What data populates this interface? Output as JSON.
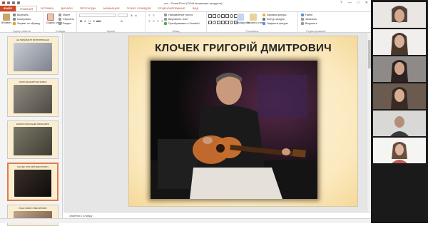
{
  "titlebar": {
    "document_title": "xxx - PowerPoint (Сбой активации продукта)",
    "window_buttons": [
      "?",
      "—",
      "□",
      "✕"
    ]
  },
  "ribbon_tabs": [
    "ФАЙЛ",
    "ГЛАВНАЯ",
    "ВСТАВКА",
    "ДИЗАЙН",
    "ПЕРЕХОДЫ",
    "АНИМАЦИЯ",
    "ПОКАЗ СЛАЙДОВ",
    "РЕЦЕНЗИРОВАНИЕ",
    "ВИД"
  ],
  "ribbon": {
    "clipboard": {
      "label": "Буфер обмена",
      "paste": "Вставить",
      "cut": "Вырезать",
      "copy": "Копировать",
      "format_painter": "Формат по образцу"
    },
    "slides": {
      "label": "Слайды",
      "new_slide": "Создать слайд",
      "layout": "Макет",
      "reset": "Сбросить",
      "section": "Раздел"
    },
    "font": {
      "label": "Шрифт"
    },
    "paragraph": {
      "label": "Абзац",
      "direction": "Направление текста",
      "align": "Выровнять текст",
      "smartart": "Преобразовать в SmartArt"
    },
    "drawing": {
      "label": "Рисование",
      "arrange": "Упорядочить",
      "quick_styles": "Экспресс-стили",
      "fill": "Заливка фигуры",
      "outline": "Контур фигуры",
      "effects": "Эффекты фигуры"
    },
    "editing": {
      "label": "Редактирование",
      "find": "Найти",
      "replace": "Заменить",
      "select": "Выделить"
    }
  },
  "thumbnails": [
    {
      "num": "",
      "title": "НЕ ПЕРЕЙМАТИ ВИПРОБУВАННЯ",
      "color": "#8a8d96"
    },
    {
      "num": "",
      "title": "ХМУРО ВАЛЕРІЙ ПЕТРОВИЧ",
      "color": "#6d6a63"
    },
    {
      "num": "",
      "title": "КЛЕРЯК ОЛЕКСАНДР ЄВГЕНОВИЧ",
      "color": "#5e5b4e"
    },
    {
      "num": "",
      "title": "КЛОЧЕК ГРИГОРІЙ ДМИТРОВИЧ",
      "color": "#1d1a17"
    },
    {
      "num": "",
      "title": "ЛІЦАК ЛЕВКО ОЛЕКСІЙОВИЧ",
      "color": "#9a7f66"
    }
  ],
  "slide": {
    "title": "КЛОЧЕК ГРИГОРІЙ ДМИТРОВИЧ"
  },
  "notes": {
    "placeholder": "Заметки к слайду"
  },
  "participants": [
    {
      "color": "#7e7570"
    },
    {
      "color": "#8d7e74"
    },
    {
      "color": "#6f6d72"
    },
    {
      "color": "#a08a7b"
    },
    {
      "color": "#8a8682"
    },
    {
      "color": "#b8b6b4"
    }
  ]
}
